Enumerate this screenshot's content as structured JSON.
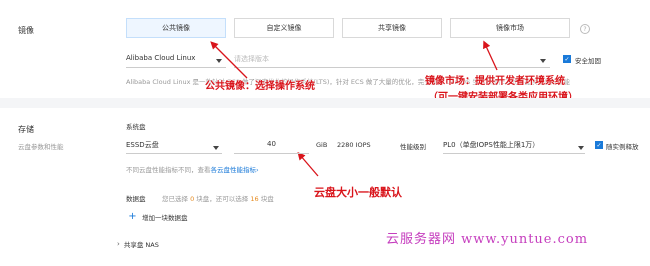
{
  "image_section": {
    "title": "镜像",
    "tabs": [
      {
        "label": "公共镜像",
        "active": true
      },
      {
        "label": "自定义镜像",
        "active": false
      },
      {
        "label": "共享镜像",
        "active": false
      },
      {
        "label": "镜像市场",
        "active": false
      }
    ],
    "os_select": "Alibaba Cloud Linux",
    "version_placeholder": "请选择版本",
    "security_label": "安全加固",
    "description": "Alibaba Cloud Linux 是一款针对 ECS 做了深度优化的操作系统(LTS)，针对 ECS 做了大量的优化，完全兼容 CentOS 生态和操作方式，提供更佳的性能"
  },
  "storage_section": {
    "title": "存储",
    "subtitle": "云盘参数和性能",
    "system_disk_label": "系统盘",
    "disk_type": "ESSD云盘",
    "disk_size": "40",
    "disk_unit": "GiB",
    "iops": "2280 IOPS",
    "perf_level_label": "性能级别",
    "perf_level_value": "PL0（单盘IOPS性能上限1万）",
    "release_label": "随实例释放",
    "disk_note_prefix": "不同云盘性能指标不同，查看",
    "disk_note_link": "各云盘性能指标",
    "data_disk_label": "数据盘",
    "data_disk_info_a": "您已选择",
    "data_disk_count_selected": "0",
    "data_disk_info_b": "块盘，还可以选择",
    "data_disk_count_remaining": "16",
    "data_disk_info_c": "块盘",
    "add_data_disk": "增加一块数据盘",
    "shared_disk": "共享盘 NAS"
  },
  "annotations": {
    "public_image_note": "公共镜像：选择操作系统",
    "market_note_line1": "镜像市场：提供开发者环境系统",
    "market_note_line2": "（可一键安装部署各类应用环境）",
    "disk_size_note": "云盘大小一般默认",
    "watermark": "云服务器网 www.yuntue.com"
  },
  "colors": {
    "accent": "#1a7ad9",
    "annotation": "#d9141b",
    "watermark": "#c53dbe",
    "warning": "#e58a1f"
  }
}
